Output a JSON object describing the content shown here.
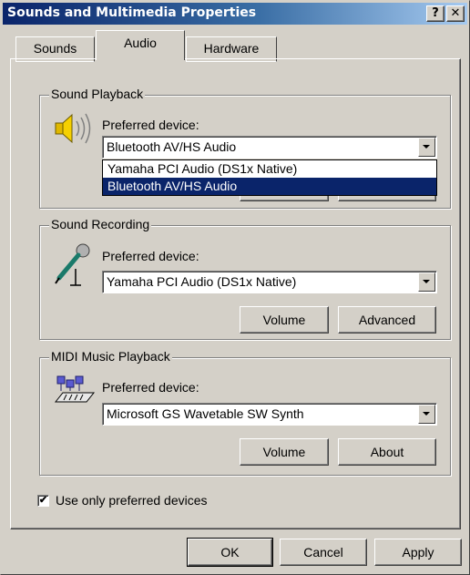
{
  "window": {
    "title": "Sounds and Multimedia Properties",
    "help_label": "?",
    "close_label": "✕"
  },
  "tabs": [
    {
      "label": "Sounds",
      "active": false
    },
    {
      "label": "Audio",
      "active": true
    },
    {
      "label": "Hardware",
      "active": false
    }
  ],
  "playback": {
    "group_label": "Sound Playback",
    "preferred_label": "Preferred device:",
    "selected_device": "Bluetooth AV/HS Audio",
    "dropdown_open": true,
    "options": [
      "Yamaha PCI Audio (DS1x Native)",
      "Bluetooth AV/HS Audio"
    ],
    "highlighted_option": "Bluetooth AV/HS Audio",
    "icon": "speaker-icon"
  },
  "recording": {
    "group_label": "Sound Recording",
    "preferred_label": "Preferred device:",
    "selected_device": "Yamaha PCI Audio (DS1x Native)",
    "volume_label": "Volume",
    "advanced_label": "Advanced",
    "icon": "microphone-icon"
  },
  "midi": {
    "group_label": "MIDI Music Playback",
    "preferred_label": "Preferred device:",
    "selected_device": "Microsoft GS Wavetable SW Synth",
    "volume_label": "Volume",
    "about_label": "About",
    "icon": "midi-keyboard-icon"
  },
  "use_preferred": {
    "label": "Use only preferred devices",
    "checked": true
  },
  "footer": {
    "ok_label": "OK",
    "cancel_label": "Cancel",
    "apply_label": "Apply"
  },
  "colors": {
    "face": "#d4d0c8",
    "title_start": "#0a246a",
    "title_end": "#a6caf0",
    "highlight": "#0a246a"
  }
}
